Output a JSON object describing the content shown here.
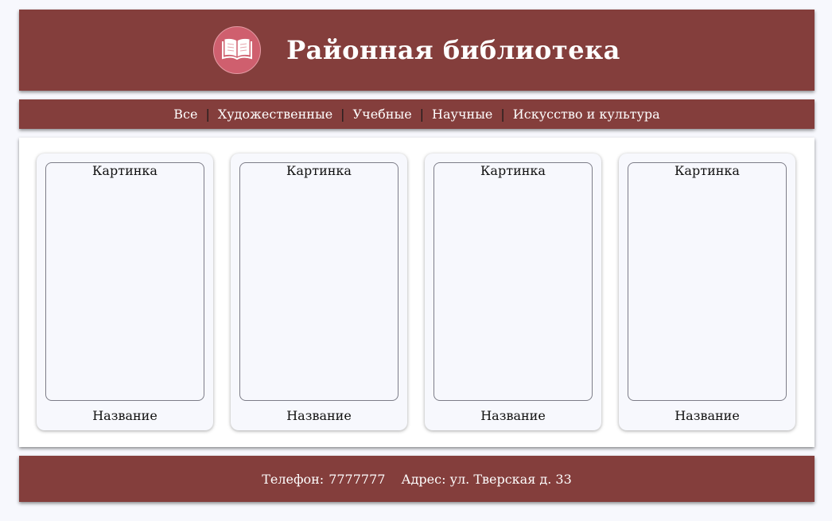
{
  "colors": {
    "brand": "#843e3c",
    "logo_circle": "#cf5f6e",
    "page_background": "#f7f8fd"
  },
  "header": {
    "logo_icon": "open-book-icon",
    "title": "Районная библиотека"
  },
  "nav": {
    "items": [
      {
        "label": "Все"
      },
      {
        "label": "Художественные"
      },
      {
        "label": "Учебные"
      },
      {
        "label": "Научные"
      },
      {
        "label": "Искусство и культура"
      }
    ],
    "separator": "|"
  },
  "cards": [
    {
      "image_label": "Картинка",
      "name": "Название"
    },
    {
      "image_label": "Картинка",
      "name": "Название"
    },
    {
      "image_label": "Картинка",
      "name": "Название"
    },
    {
      "image_label": "Картинка",
      "name": "Название"
    }
  ],
  "footer": {
    "phone_label": "Телефон:",
    "phone_value": "7777777",
    "address": "Адрес: ул. Тверская д. 33"
  }
}
